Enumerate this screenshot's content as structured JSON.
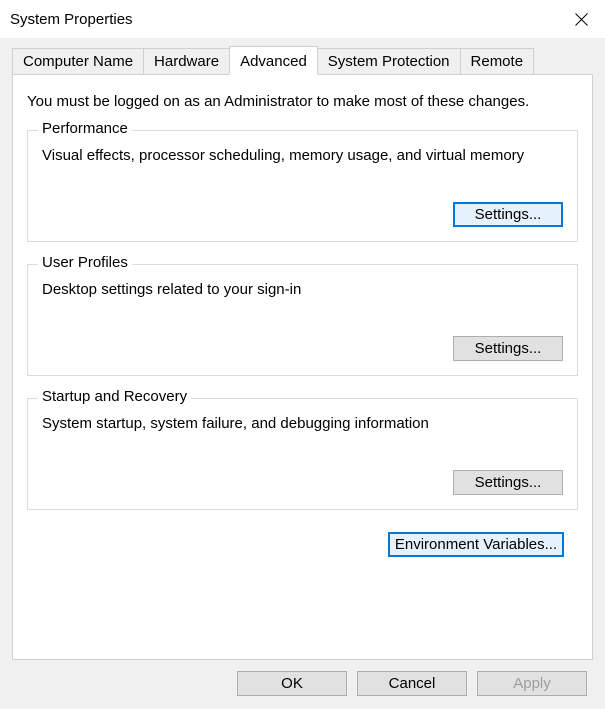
{
  "window": {
    "title": "System Properties"
  },
  "tabs": [
    {
      "label": "Computer Name"
    },
    {
      "label": "Hardware"
    },
    {
      "label": "Advanced"
    },
    {
      "label": "System Protection"
    },
    {
      "label": "Remote"
    }
  ],
  "intro": "You must be logged on as an Administrator to make most of these changes.",
  "performance": {
    "legend": "Performance",
    "desc": "Visual effects, processor scheduling, memory usage, and virtual memory",
    "button": "Settings..."
  },
  "userprofiles": {
    "legend": "User Profiles",
    "desc": "Desktop settings related to your sign-in",
    "button": "Settings..."
  },
  "startup": {
    "legend": "Startup and Recovery",
    "desc": "System startup, system failure, and debugging information",
    "button": "Settings..."
  },
  "envvars": {
    "button": "Environment Variables..."
  },
  "footer": {
    "ok": "OK",
    "cancel": "Cancel",
    "apply": "Apply"
  }
}
